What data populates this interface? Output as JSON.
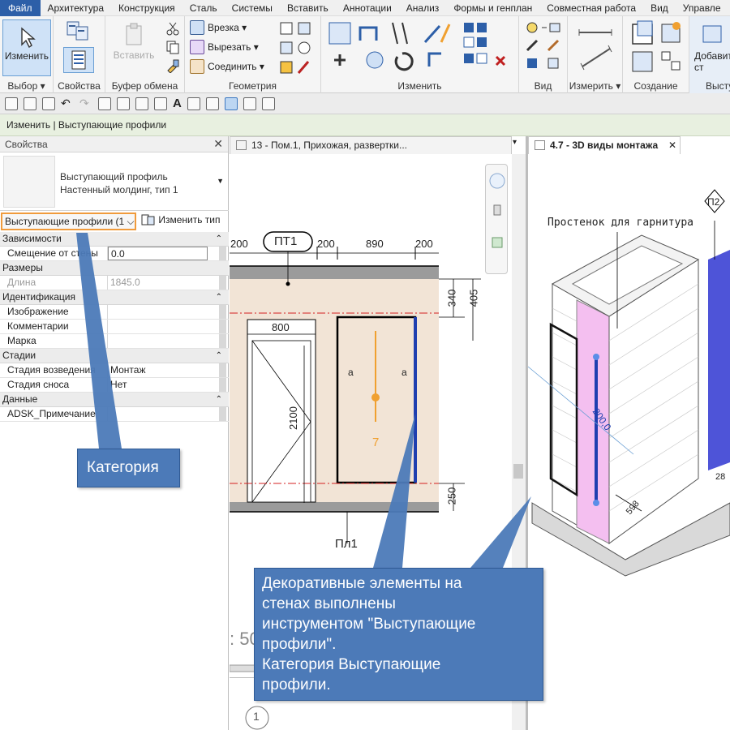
{
  "menu": {
    "file": "Файл",
    "items": [
      "Архитектура",
      "Конструкция",
      "Сталь",
      "Системы",
      "Вставить",
      "Аннотации",
      "Анализ",
      "Формы и генплан",
      "Совместная работа",
      "Вид",
      "Управле"
    ]
  },
  "ribbon": {
    "modify_label": "Изменить",
    "panels": {
      "select": "Выбор",
      "properties": "Свойства",
      "clipboard": "Буфер обмена",
      "geometry": "Геометрия",
      "modify": "Изменить",
      "view": "Вид",
      "measure": "Измерить",
      "create": "Создание",
      "extrusions": "Выступ"
    },
    "paste_label": "Вставить",
    "geometry_tools": [
      "Врезка",
      "Вырезать",
      "Соединить"
    ],
    "add_label": "Добавит\nст"
  },
  "status": {
    "text": "Изменить | Выступающие профили"
  },
  "properties": {
    "title": "Свойства",
    "type_line1": "Выступающий профиль",
    "type_line2": "Настенный молдинг, тип 1",
    "category_selector": "Выступающие профили (1",
    "edit_type": "Изменить тип",
    "sections": [
      {
        "name": "Зависимости",
        "rows": [
          {
            "key": "Смещение от стены",
            "value": "0.0",
            "editable": true
          }
        ]
      },
      {
        "name": "Размеры",
        "rows": [
          {
            "key": "Длина",
            "value": "1845.0",
            "dim": true
          }
        ]
      },
      {
        "name": "Идентификация",
        "rows": [
          {
            "key": "Изображение",
            "value": ""
          },
          {
            "key": "Комментарии",
            "value": ""
          },
          {
            "key": "Марка",
            "value": ""
          }
        ]
      },
      {
        "name": "Стадии",
        "rows": [
          {
            "key": "Стадия возведения",
            "value": "Монтаж"
          },
          {
            "key": "Стадия сноса",
            "value": "Нет"
          }
        ]
      },
      {
        "name": "Данные",
        "rows": [
          {
            "key": "ADSK_Примечание",
            "value": ""
          }
        ]
      }
    ]
  },
  "tabs": {
    "view1": "13 - Пом.1, Прихожая, развертки...",
    "view2": "4.7 - 3D виды монтажа"
  },
  "drawing": {
    "tag": "ПТ1",
    "dims_top": [
      "200",
      "200",
      "890",
      "200"
    ],
    "dim_800": "800",
    "dim_2100": "2100",
    "dim_340": "340",
    "dim_405": "405",
    "dim_250": "250",
    "floor_tag": "Пл1",
    "center_num": "7",
    "a_left": "a",
    "a_right": "a",
    "scale_hint": ": 50",
    "grid_bubble": "1"
  },
  "view3d": {
    "note": "Простенок для гарнитура",
    "tag": "П2",
    "dim_598": "598",
    "dim_2000": "200,0",
    "dim_edge": "28"
  },
  "callouts": {
    "category": "Категория",
    "explain": "Декоративные элементы на\nстенах выполнены\nинструментом \"Выступающие\nпрофили\".\nКатегория Выступающие\nпрофили."
  },
  "colors": {
    "accent_file": "#2d5fa8",
    "callout": "#4c7ab8",
    "highlight_orange": "#f09b3c",
    "status_bg": "#e8f0e0",
    "profile_blue": "#1f3fb0",
    "pink_panel": "#f4bff0"
  }
}
